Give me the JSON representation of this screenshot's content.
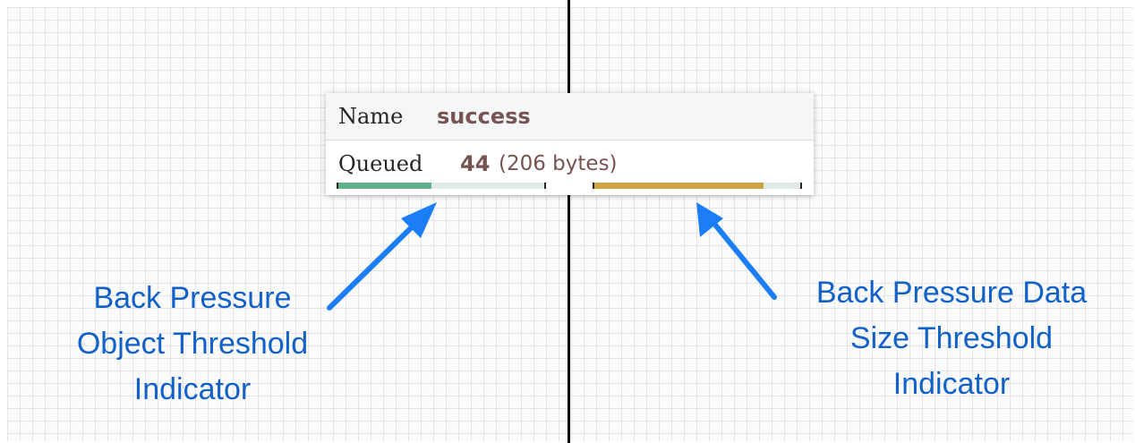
{
  "connection": {
    "name_label": "Name",
    "name_value": "success",
    "queued_label": "Queued",
    "queued_count": "44",
    "queued_size": "(206 bytes)",
    "object_threshold_percent": 45,
    "data_size_threshold_percent": 82,
    "colors": {
      "object_fill": "#5fb28a",
      "data_size_fill": "#cea443",
      "value_text": "#775351"
    }
  },
  "callouts": {
    "left": [
      "Back Pressure",
      "Object Threshold",
      "Indicator"
    ],
    "right": [
      "Back Pressure Data",
      "Size Threshold",
      "Indicator"
    ],
    "color": "#1261c9"
  }
}
